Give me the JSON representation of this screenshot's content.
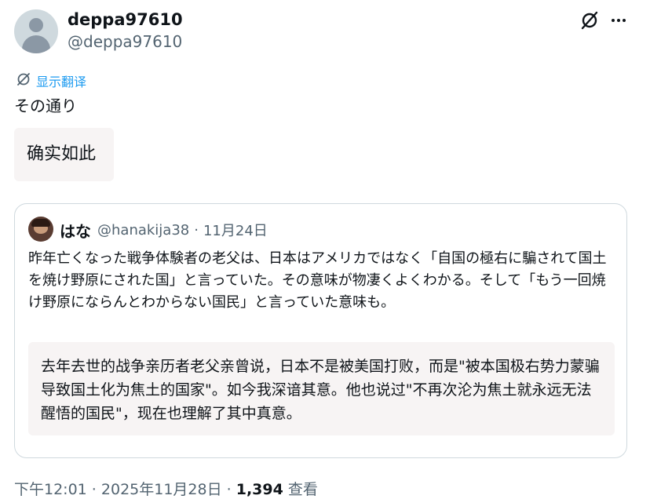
{
  "post": {
    "display_name": "deppa97610",
    "handle": "@deppa97610",
    "translate_label": "显示翻译",
    "text": "その通り",
    "translation": "确实如此"
  },
  "quote": {
    "display_name": "はな",
    "handle": "@hanakija38",
    "separator": "·",
    "date": "11月24日",
    "text": "昨年亡くなった戦争体験者の老父は、日本はアメリカではなく「自国の極右に騙されて国土を焼け野原にされた国」と言っていた。その意味が物凄くよくわかる。そして「もう一回焼け野原にならんとわからない国民」と言っていた意味も。",
    "translation": "去年去世的战争亲历者老父亲曾说，日本不是被美国打败，而是\"被本国极右势力蒙骗导致国土化为焦土的国家\"。如今我深谙其意。他也说过\"不再次沦为焦土就永远无法醒悟的国民\"，现在也理解了其中真意。"
  },
  "footer": {
    "time": "下午12:01",
    "sep1": " · ",
    "date": "2025年11月28日",
    "sep2": " · ",
    "views_count": "1,394",
    "views_label": " 查看"
  },
  "icons": {
    "grok": "grok-icon",
    "more": "more-icon",
    "translate": "translate-icon"
  },
  "colors": {
    "link": "#1d9bf0",
    "secondary_text": "#536471",
    "translation_bg": "#f7f4f4"
  }
}
